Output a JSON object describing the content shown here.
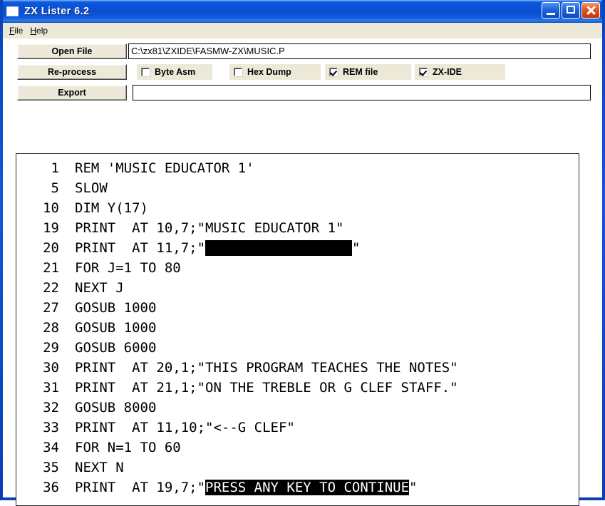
{
  "window": {
    "title": "ZX Lister 6.2",
    "icon": "app-window-icon",
    "caption": {
      "minimize": "minimize-icon",
      "maximize": "maximize-icon",
      "close": "close-icon"
    }
  },
  "menubar": {
    "items": [
      {
        "label": "File",
        "mnemonic": "F",
        "rest": "ile"
      },
      {
        "label": "Help",
        "mnemonic": "H",
        "rest": "elp"
      }
    ]
  },
  "toolbar": {
    "open_file_label": "Open File",
    "reprocess_label": "Re-process",
    "export_label": "Export",
    "path_field": {
      "value": "C:\\zx81\\ZXIDE\\FASMW-ZX\\MUSIC.P",
      "placeholder": ""
    },
    "export_field": {
      "value": "",
      "placeholder": ""
    },
    "checkboxes": [
      {
        "label": "Byte Asm",
        "checked": false
      },
      {
        "label": "Hex Dump",
        "checked": false
      },
      {
        "label": "REM file",
        "checked": true
      },
      {
        "label": "ZX-IDE",
        "checked": true
      }
    ]
  },
  "listing": {
    "lines": [
      {
        "num": "1",
        "segments": [
          {
            "text": "REM 'MUSIC EDUCATOR 1'",
            "inverse": false
          }
        ]
      },
      {
        "num": "5",
        "segments": [
          {
            "text": "SLOW",
            "inverse": false
          }
        ]
      },
      {
        "num": "10",
        "segments": [
          {
            "text": "DIM Y(17)",
            "inverse": false
          }
        ]
      },
      {
        "num": "19",
        "segments": [
          {
            "text": "PRINT  AT 10,7;\"MUSIC EDUCATOR 1\"",
            "inverse": false
          }
        ]
      },
      {
        "num": "20",
        "segments": [
          {
            "text": "PRINT  AT 11,7;\"",
            "inverse": false
          },
          {
            "text": "                  ",
            "inverse": true
          },
          {
            "text": "\"",
            "inverse": false
          }
        ]
      },
      {
        "num": "21",
        "segments": [
          {
            "text": "FOR J=1 TO 80",
            "inverse": false
          }
        ]
      },
      {
        "num": "22",
        "segments": [
          {
            "text": "NEXT J",
            "inverse": false
          }
        ]
      },
      {
        "num": "27",
        "segments": [
          {
            "text": "GOSUB 1000",
            "inverse": false
          }
        ]
      },
      {
        "num": "28",
        "segments": [
          {
            "text": "GOSUB 1000",
            "inverse": false
          }
        ]
      },
      {
        "num": "29",
        "segments": [
          {
            "text": "GOSUB 6000",
            "inverse": false
          }
        ]
      },
      {
        "num": "30",
        "segments": [
          {
            "text": "PRINT  AT 20,1;\"THIS PROGRAM TEACHES THE NOTES\"",
            "inverse": false
          }
        ]
      },
      {
        "num": "31",
        "segments": [
          {
            "text": "PRINT  AT 21,1;\"ON THE TREBLE OR G CLEF STAFF.\"",
            "inverse": false
          }
        ]
      },
      {
        "num": "32",
        "segments": [
          {
            "text": "GOSUB 8000",
            "inverse": false
          }
        ]
      },
      {
        "num": "33",
        "segments": [
          {
            "text": "PRINT  AT 11,10;\"<--G CLEF\"",
            "inverse": false
          }
        ]
      },
      {
        "num": "34",
        "segments": [
          {
            "text": "FOR N=1 TO 60",
            "inverse": false
          }
        ]
      },
      {
        "num": "35",
        "segments": [
          {
            "text": "NEXT N",
            "inverse": false
          }
        ]
      },
      {
        "num": "36",
        "segments": [
          {
            "text": "PRINT  AT 19,7;\"",
            "inverse": false
          },
          {
            "text": "PRESS ANY KEY TO CONTINUE",
            "inverse": true
          },
          {
            "text": "\"",
            "inverse": false
          }
        ]
      }
    ]
  },
  "colors": {
    "titlebar_blue": "#0b52d6",
    "face": "#ece9d8",
    "close_red": "#e25b22",
    "text": "#000000",
    "panel_bg": "#ffffff"
  }
}
